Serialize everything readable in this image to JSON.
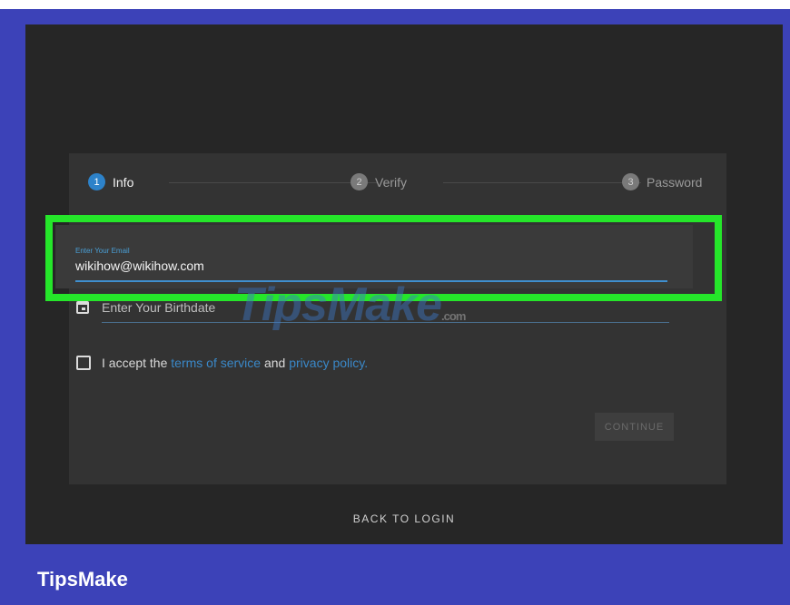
{
  "stepper": {
    "steps": [
      {
        "number": "1",
        "label": "Info"
      },
      {
        "number": "2",
        "label": "Verify"
      },
      {
        "number": "3",
        "label": "Password"
      }
    ]
  },
  "form": {
    "email": {
      "label": "Enter Your Email",
      "value": "wikihow@wikihow.com"
    },
    "birthdate": {
      "placeholder": "Enter Your Birthdate",
      "icon": "calendar-icon"
    },
    "terms": {
      "prefix": "I accept the",
      "terms_link": "terms of service",
      "middle": "and",
      "privacy_link": "privacy policy",
      "suffix": "."
    },
    "continue_label": "CONTINUE"
  },
  "back_to_login": "BACK TO LOGIN",
  "watermark": {
    "main": "TipsMake",
    "suffix": ".com"
  },
  "brand": "TipsMake",
  "colors": {
    "accent": "#2d82c9",
    "highlight": "#25e62a",
    "frame": "#3c42b8",
    "link": "#3a88c8"
  }
}
